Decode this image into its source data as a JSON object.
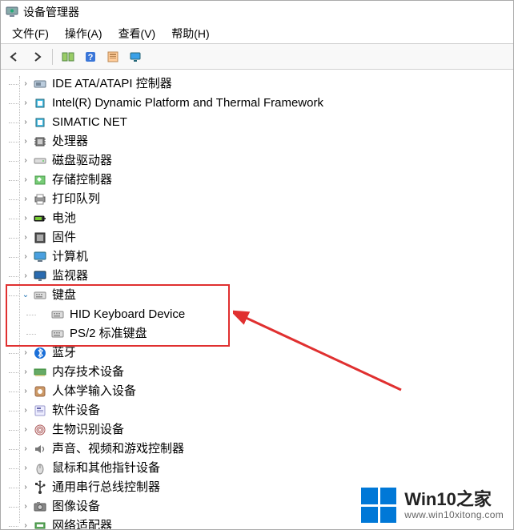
{
  "title": "设备管理器",
  "menu": {
    "file": "文件(F)",
    "action": "操作(A)",
    "view": "查看(V)",
    "help": "帮助(H)"
  },
  "tree": {
    "items": [
      {
        "label": "IDE ATA/ATAPI 控制器",
        "icon": "ide"
      },
      {
        "label": "Intel(R) Dynamic Platform and Thermal Framework",
        "icon": "chip"
      },
      {
        "label": "SIMATIC NET",
        "icon": "chip"
      },
      {
        "label": "处理器",
        "icon": "cpu"
      },
      {
        "label": "磁盘驱动器",
        "icon": "disk"
      },
      {
        "label": "存储控制器",
        "icon": "storage"
      },
      {
        "label": "打印队列",
        "icon": "printer"
      },
      {
        "label": "电池",
        "icon": "battery"
      },
      {
        "label": "固件",
        "icon": "firmware"
      },
      {
        "label": "计算机",
        "icon": "computer"
      },
      {
        "label": "监视器",
        "icon": "monitor"
      },
      {
        "label": "键盘",
        "icon": "keyboard",
        "expanded": true,
        "children": [
          {
            "label": "HID Keyboard Device",
            "icon": "keyboard"
          },
          {
            "label": "PS/2 标准键盘",
            "icon": "keyboard"
          }
        ]
      },
      {
        "label": "蓝牙",
        "icon": "bluetooth"
      },
      {
        "label": "内存技术设备",
        "icon": "memory"
      },
      {
        "label": "人体学输入设备",
        "icon": "hid"
      },
      {
        "label": "软件设备",
        "icon": "software"
      },
      {
        "label": "生物识别设备",
        "icon": "biometric"
      },
      {
        "label": "声音、视频和游戏控制器",
        "icon": "sound"
      },
      {
        "label": "鼠标和其他指针设备",
        "icon": "mouse"
      },
      {
        "label": "通用串行总线控制器",
        "icon": "usb"
      },
      {
        "label": "图像设备",
        "icon": "camera"
      },
      {
        "label": "网络适配器",
        "icon": "network"
      }
    ]
  },
  "watermark": {
    "title": "Win10之家",
    "url": "www.win10xitong.com"
  }
}
